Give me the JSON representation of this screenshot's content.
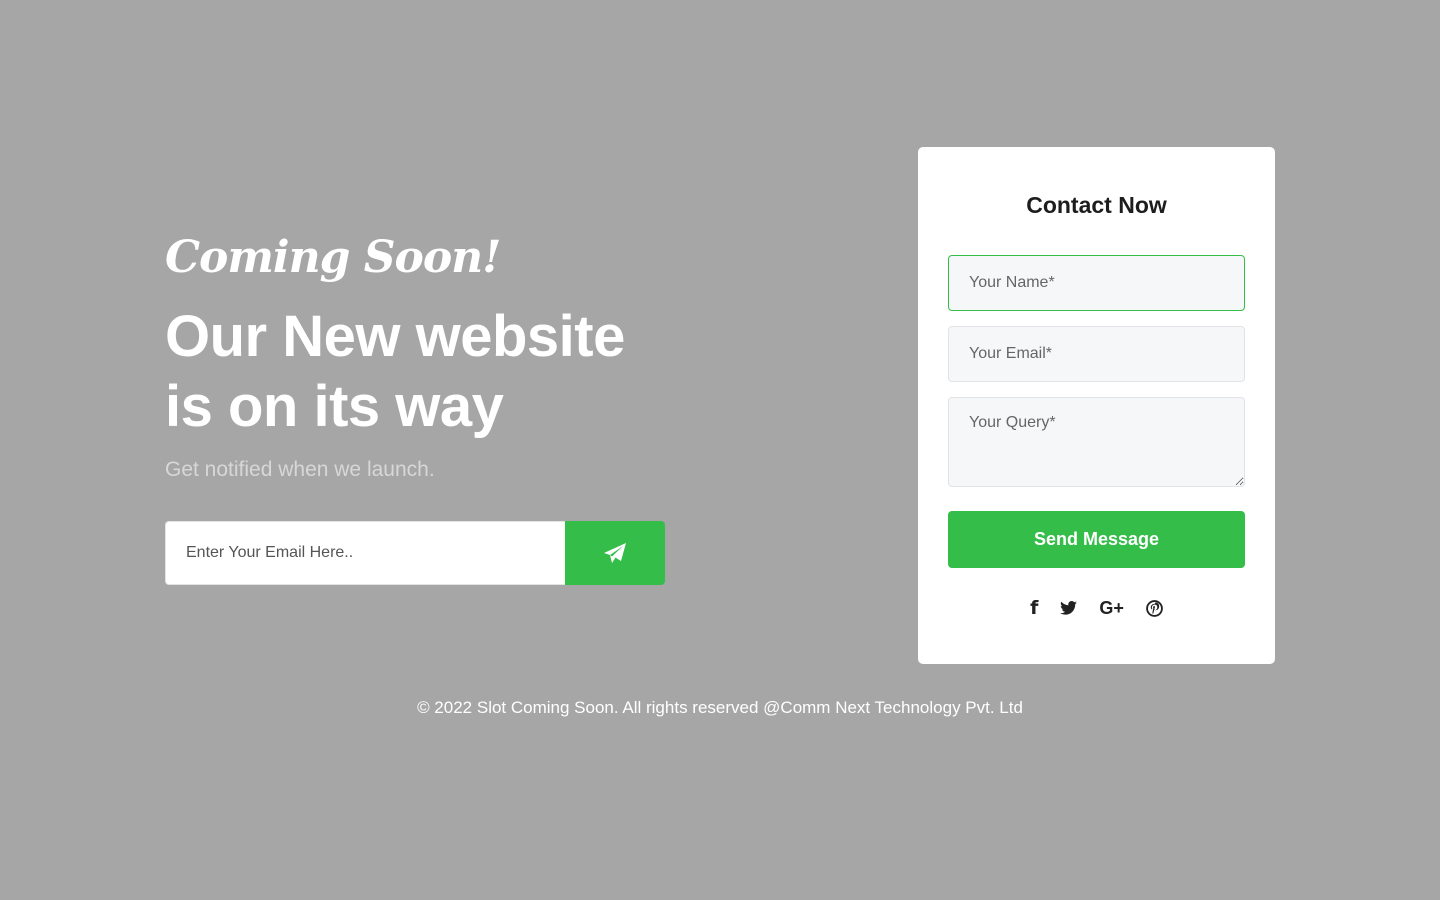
{
  "hero": {
    "script_title": "Coming Soon!",
    "headline_line1": "Our New website",
    "headline_line2": "is on its way",
    "subtitle": "Get notified when we launch."
  },
  "subscribe": {
    "placeholder": "Enter Your Email Here..",
    "button_icon": "paper-plane-icon"
  },
  "contact": {
    "title": "Contact Now",
    "name_placeholder": "Your Name*",
    "email_placeholder": "Your Email*",
    "query_placeholder": "Your Query*",
    "submit_label": "Send Message"
  },
  "socials": [
    {
      "icon": "facebook-icon",
      "glyph": "f"
    },
    {
      "icon": "twitter-icon"
    },
    {
      "icon": "google-plus-icon",
      "glyph": "G+"
    },
    {
      "icon": "pinterest-icon"
    }
  ],
  "footer": {
    "text": "© 2022 Slot Coming Soon. All rights reserved @Comm Next Technology Pvt. Ltd"
  },
  "colors": {
    "background": "#a6a6a6",
    "accent": "#35bd4a",
    "card": "#ffffff"
  }
}
